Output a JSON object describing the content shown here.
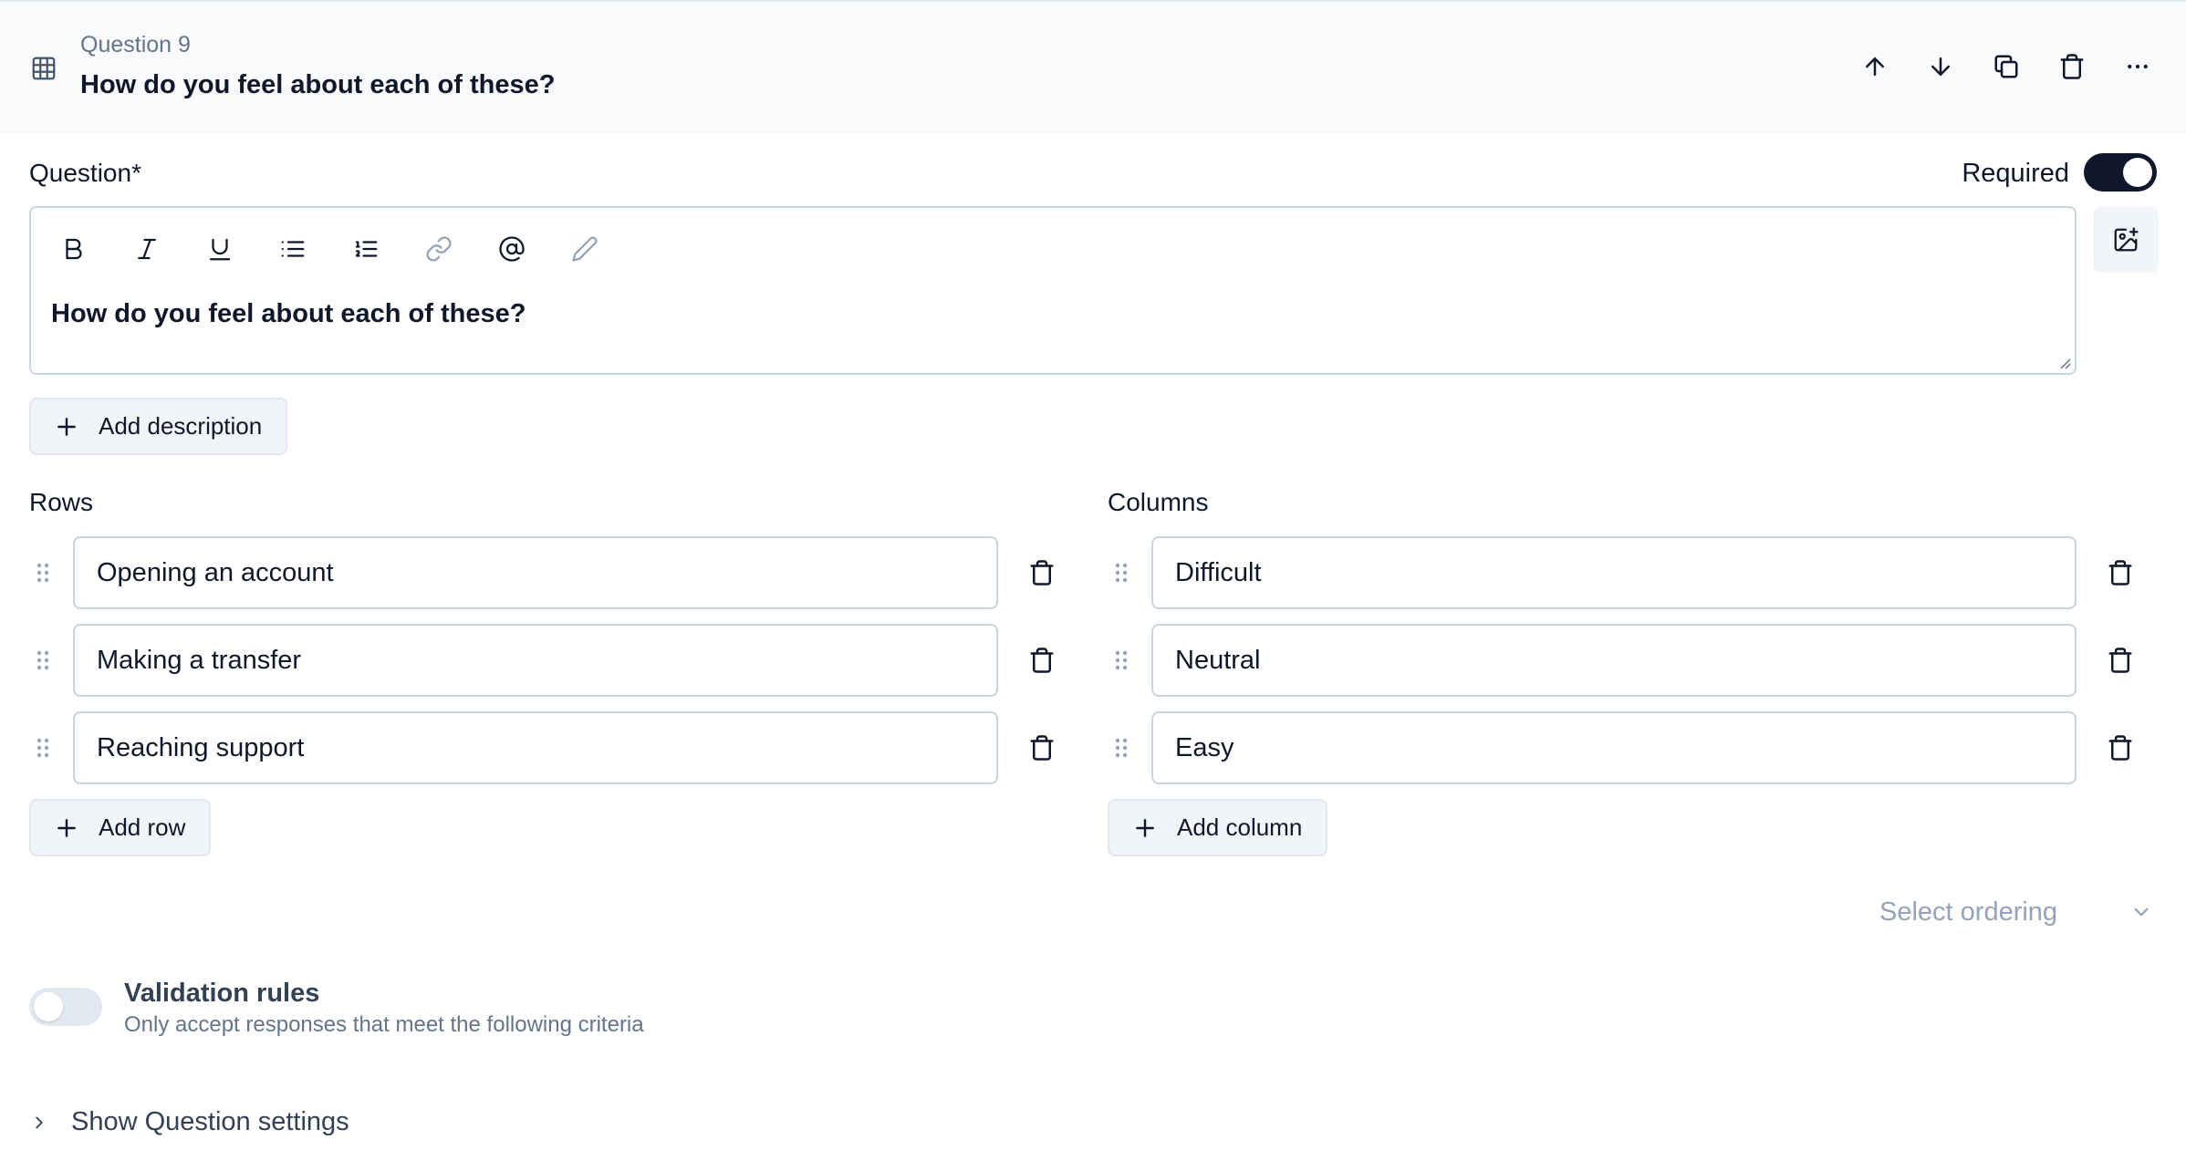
{
  "header": {
    "question_number": "Question 9",
    "question_title": "How do you feel about each of these?",
    "icons": [
      "table-grid-icon",
      "arrow-up-icon",
      "arrow-down-icon",
      "copy-icon",
      "trash-icon",
      "more-horizontal-icon"
    ]
  },
  "question": {
    "label": "Question*",
    "required_label": "Required",
    "required": true,
    "text": "How do you feel about each of these?",
    "toolbar": [
      "bold-icon",
      "italic-icon",
      "underline-icon",
      "bullet-list-icon",
      "numbered-list-icon",
      "link-icon",
      "mention-icon",
      "pencil-icon"
    ],
    "add_description_label": "Add description"
  },
  "rows": {
    "label": "Rows",
    "items": [
      {
        "value": "Opening an account"
      },
      {
        "value": "Making a transfer"
      },
      {
        "value": "Reaching support"
      }
    ],
    "add_label": "Add row"
  },
  "columns": {
    "label": "Columns",
    "items": [
      {
        "value": "Difficult"
      },
      {
        "value": "Neutral"
      },
      {
        "value": "Easy"
      }
    ],
    "add_label": "Add column"
  },
  "ordering": {
    "placeholder": "Select ordering"
  },
  "validation": {
    "enabled": false,
    "title": "Validation rules",
    "subtitle": "Only accept responses that meet the following criteria"
  },
  "settings": {
    "toggle_label": "Show Question settings"
  },
  "colors": {
    "primary": "#0f172a",
    "muted": "#64748b",
    "border": "#cbd5e1",
    "header_bg": "#f8fafc",
    "button_bg": "#f1f5f9"
  }
}
